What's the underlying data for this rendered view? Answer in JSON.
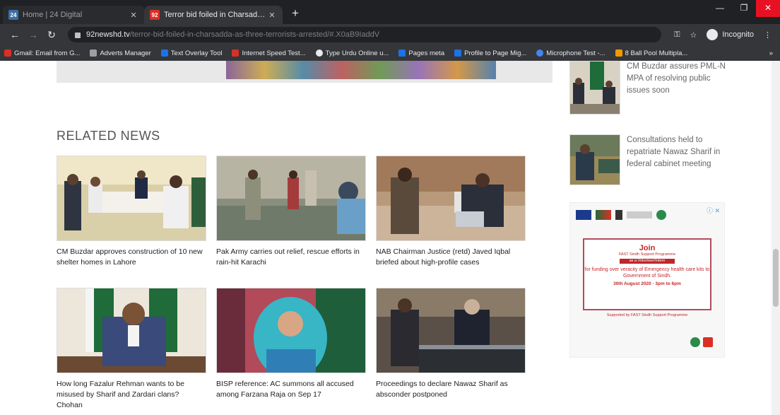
{
  "browser": {
    "tabs": [
      {
        "title": "Home | 24 Digital",
        "favicon_text": "24",
        "favicon_color": "#3b6fa3"
      },
      {
        "title": "Terror bid foiled in Charsadda as ...",
        "favicon_text": "92",
        "favicon_color": "#d93025"
      }
    ],
    "url_host": "92newshd.tv",
    "url_path": "/terror-bid-foiled-in-charsadda-as-three-terrorists-arrested/#.X0aB9IaddV",
    "incognito_label": "Incognito",
    "bookmarks": [
      {
        "label": "Gmail: Email from G...",
        "color": "#d93025"
      },
      {
        "label": "Adverts Manager",
        "color": "#9aa0a6"
      },
      {
        "label": "Text Overlay Tool",
        "color": "#1a73e8"
      },
      {
        "label": "Internet Speed Test...",
        "color": "#d93025"
      },
      {
        "label": "Type Urdu Online u...",
        "color": "#e8eaed"
      },
      {
        "label": "Pages meta",
        "color": "#1a73e8"
      },
      {
        "label": "Profile to Page Mig...",
        "color": "#1a73e8"
      },
      {
        "label": "Microphone Test -...",
        "color": "#4285f4"
      },
      {
        "label": "8 Ball Pool Multipla...",
        "color": "#f29900"
      }
    ],
    "bookmarks_more": "»"
  },
  "page": {
    "related_heading": "RELATED NEWS",
    "related": [
      {
        "caption": "CM Buzdar approves construction of 10 new shelter homes in Lahore",
        "photo": "meeting-photo"
      },
      {
        "caption": "Pak Army carries out relief, rescue efforts in rain-hit Karachi",
        "photo": "flood-relief-photo"
      },
      {
        "caption": "NAB Chairman Justice (retd) Javed Iqbal briefed about high-profile cases",
        "photo": "briefing-photo"
      },
      {
        "caption": "How long Fazalur Rehman wants to be misused by Sharif and Zardari clans? Chohan",
        "photo": "official-portrait-photo"
      },
      {
        "caption": "BISP reference: AC summons all accused among Farzana Raja on Sep 17",
        "photo": "woman-portrait-photo"
      },
      {
        "caption": "Proceedings to declare Nawaz Sharif as absconder postponed",
        "photo": "car-photo"
      }
    ],
    "sidebar": [
      {
        "text": "CM Buzdar assures PML-N MPA of resolving public issues soon"
      },
      {
        "text": "Consultations held to repatriate Nawaz Sharif in federal cabinet meeting"
      }
    ],
    "ad": {
      "join": "Join",
      "program": "FAST Sindh Support Programme",
      "program_sub": "as a Volunteer/Intern",
      "body": "for funding over veracity of Emergency health care kits to Government of Sindh.",
      "date": "30th August 2020 - 3pm to 6pm",
      "footer": "Supported by FAST Sindh Support Programme",
      "ad_marker": "ⓘ ✕"
    }
  },
  "colors": {
    "chrome_dark": "#202124",
    "chrome_mid": "#35363a",
    "heading": "#555555",
    "ad_red": "#c0262a"
  }
}
